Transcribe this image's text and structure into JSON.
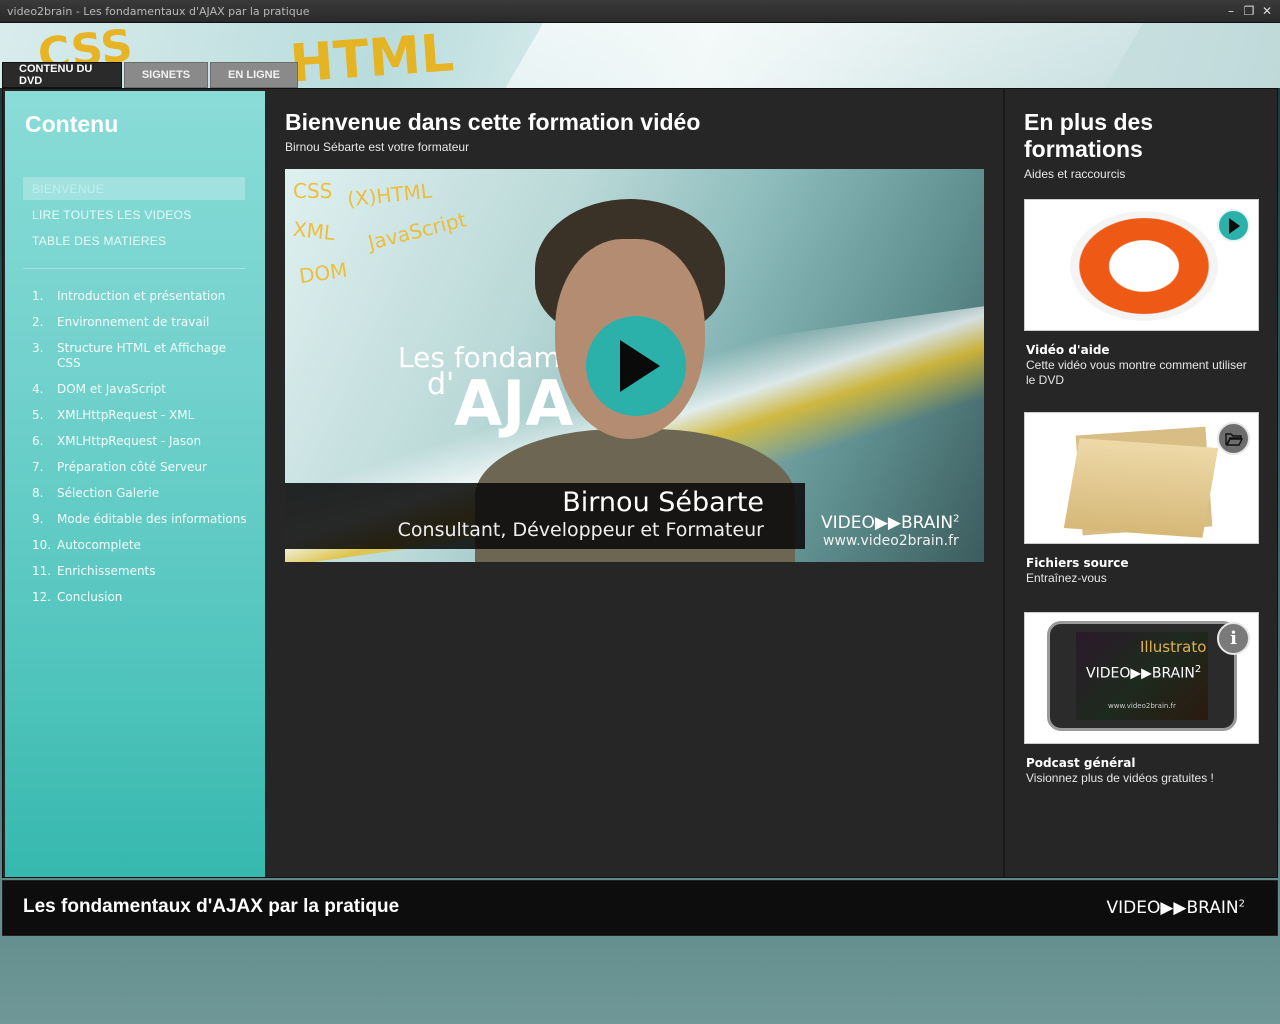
{
  "window": {
    "title": "video2brain - Les fondamentaux d'AJAX par la pratique",
    "controls": [
      "minimize",
      "restore",
      "close"
    ]
  },
  "banner": {
    "bg_words": [
      "CSS",
      "HTML"
    ]
  },
  "tabs": [
    {
      "label": "CONTENU DU DVD",
      "active": true
    },
    {
      "label": "SIGNETS",
      "active": false
    },
    {
      "label": "EN LIGNE",
      "active": false
    }
  ],
  "sidebar": {
    "title": "Contenu",
    "links": [
      {
        "label": "BIENVENUE",
        "active": true
      },
      {
        "label": "LIRE TOUTES LES VIDEOS",
        "active": false
      },
      {
        "label": "TABLE DES MATIERES",
        "active": false
      }
    ],
    "chapters": [
      {
        "num": "1.",
        "title": "Introduction et présentation"
      },
      {
        "num": "2.",
        "title": "Environnement de travail"
      },
      {
        "num": "3.",
        "title": "Structure HTML et Affichage CSS"
      },
      {
        "num": "4.",
        "title": "DOM et JavaScript"
      },
      {
        "num": "5.",
        "title": "XMLHttpRequest - XML"
      },
      {
        "num": "6.",
        "title": "XMLHttpRequest - Jason"
      },
      {
        "num": "7.",
        "title": "Préparation côté Serveur"
      },
      {
        "num": "8.",
        "title": "Sélection Galerie"
      },
      {
        "num": "9.",
        "title": "Mode éditable des informations"
      },
      {
        "num": "10.",
        "title": "Autocomplete"
      },
      {
        "num": "11.",
        "title": "Enrichissements"
      },
      {
        "num": "12.",
        "title": "Conclusion"
      }
    ]
  },
  "center": {
    "title": "Bienvenue dans cette formation vidéo",
    "subtitle": "Birnou Sébarte est votre formateur",
    "video": {
      "keywords": [
        "CSS",
        "(X)HTML",
        "XML",
        "JavaScript",
        "DOM"
      ],
      "course_line1": "Les fondamen",
      "course_line2_prefix": "d'",
      "course_line2": "AJA",
      "presenter_name": "Birnou Sébarte",
      "presenter_role": "Consultant, Développeur et Formateur",
      "logo": "VIDEO▶▶BRAIN",
      "logo_sup": "2",
      "url": "www.video2brain.fr"
    }
  },
  "right": {
    "title": "En plus des formations",
    "subtitle": "Aides et raccourcis",
    "cards": [
      {
        "title": "Vidéo d'aide",
        "desc": "Cette vidéo vous montre comment utiliser le DVD",
        "badge_icon": "play-icon"
      },
      {
        "title": "Fichiers source",
        "desc": "Entraînez-vous",
        "badge_icon": "folder-open-icon"
      },
      {
        "title": "Podcast général",
        "desc": "Visionnez plus de vidéos gratuites !",
        "badge_icon": "info-icon"
      }
    ],
    "podcast_screen": {
      "line1": "Illustrato",
      "line2": "VIDEO▶▶BRAIN",
      "sup": "2",
      "url": "www.video2brain.fr"
    }
  },
  "footer": {
    "title": "Les fondamentaux d'AJAX par la pratique",
    "logo": "VIDEO▶▶BRAIN",
    "logo_sup": "2"
  },
  "colors": {
    "sidebar_top": "#8adcd8",
    "sidebar_bottom": "#36b8ae",
    "accent_play": "#2bb0aa",
    "panel_bg": "#262626",
    "footer_bg": "#0d0d0d"
  }
}
